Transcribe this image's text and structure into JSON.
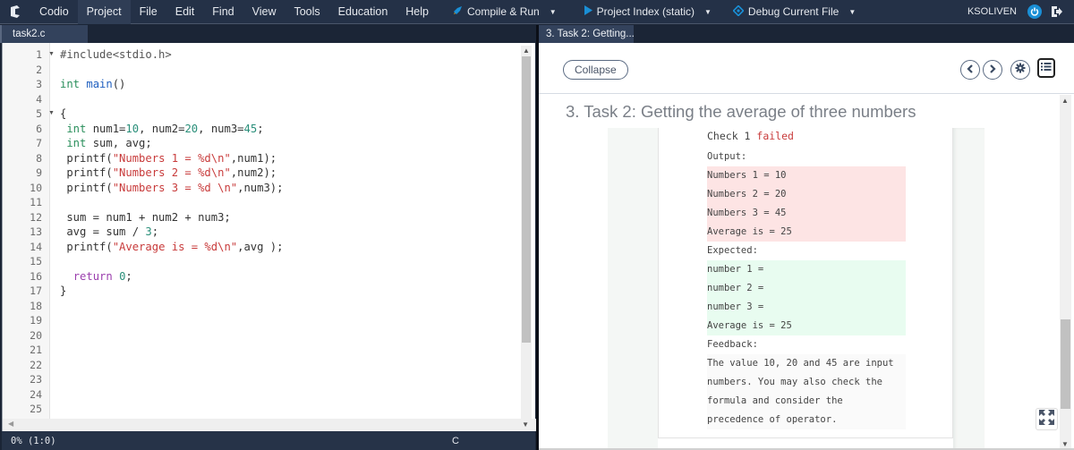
{
  "menubar": {
    "logo": "codio-logo-icon",
    "items": [
      "Codio",
      "Project",
      "File",
      "Edit",
      "Find",
      "View",
      "Tools",
      "Education",
      "Help"
    ],
    "active_item": "Project",
    "tools": [
      {
        "label": "Compile & Run",
        "icon": "rocket-icon",
        "color": "#1a8fd6"
      },
      {
        "label": "Project Index (static)",
        "icon": "play-icon",
        "color": "#1a8fd6"
      },
      {
        "label": "Debug Current File",
        "icon": "crosshair-icon",
        "color": "#1a8fd6"
      }
    ],
    "username": "KSOLIVEN"
  },
  "editor": {
    "tab_label": "task2.c",
    "line_numbers": [
      "1",
      "2",
      "3",
      "4",
      "5",
      "6",
      "7",
      "8",
      "9",
      "10",
      "11",
      "12",
      "13",
      "14",
      "15",
      "16",
      "17",
      "18",
      "19",
      "20",
      "21",
      "22",
      "23",
      "24",
      "25"
    ],
    "folded_lines": [
      1,
      5
    ],
    "code": [
      "#include<stdio.h>",
      "",
      "int main()",
      "",
      "{",
      " int num1=10, num2=20, num3=45;",
      " int sum, avg;",
      " printf(\"Numbers 1 = %d\\n\",num1);",
      " printf(\"Numbers 2 = %d\\n\",num2);",
      " printf(\"Numbers 3 = %d \\n\",num3);",
      "",
      " sum = num1 + num2 + num3;",
      " avg = sum / 3;",
      " printf(\"Average is = %d\\n\",avg );",
      "",
      "  return 0;",
      "}"
    ],
    "status": {
      "position": "0% (1:0)",
      "language": "C"
    }
  },
  "guide": {
    "tab_label": "3. Task 2: Getting...",
    "collapse_label": "Collapse",
    "title": "3. Task 2: Getting the average of three numbers",
    "check": {
      "prefix": "Check 1 ",
      "status": "failed",
      "output_label": "Output:",
      "output_lines": [
        "Numbers 1 = 10",
        "Numbers 2 = 20",
        "Numbers 3 = 45",
        "Average is = 25"
      ],
      "expected_label": "Expected:",
      "expected_lines": [
        "number 1 =",
        "number 2 =",
        "number 3 =",
        "Average is = 25"
      ],
      "feedback_label": "Feedback:",
      "feedback_lines": [
        "The value 10, 20 and 45 are input",
        "numbers. You may also check the",
        "formula and consider the",
        "precedence of operator."
      ]
    }
  },
  "colors": {
    "menubar_bg": "#243147",
    "accent": "#1a8fd6",
    "failed": "#c83b3b",
    "output_bg": "#fde4e4",
    "expected_bg": "#e8fcf0"
  }
}
